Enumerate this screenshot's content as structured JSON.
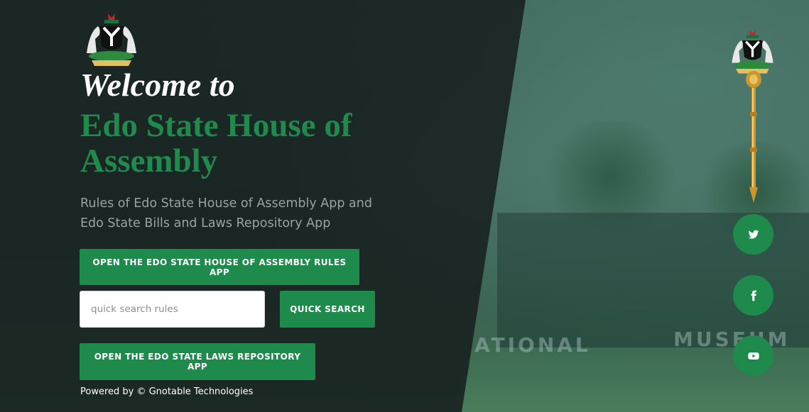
{
  "hero": {
    "welcome": "Welcome to",
    "title": "Edo State House of Assembly",
    "subtitle": "Rules of Edo State House of Assembly App and Edo State Bills and Laws Repository App"
  },
  "actions": {
    "rules_button": "OPEN THE EDO STATE HOUSE OF ASSEMBLY RULES APP",
    "search_placeholder": "quick search rules",
    "search_value": "",
    "search_button": "QUICK SEARCH",
    "laws_button": "OPEN THE EDO STATE LAWS REPOSITORY APP"
  },
  "footer": {
    "powered_by": "Powered by © Gnotable Technologies"
  },
  "background": {
    "sign_text_left": "ATIONAL",
    "sign_text_right": "MUSEUM"
  },
  "social": [
    {
      "icon": "twitter-icon"
    },
    {
      "icon": "facebook-icon"
    },
    {
      "icon": "youtube-icon"
    }
  ],
  "colors": {
    "accent": "#1e8a4b",
    "title_green": "#1f8a4c",
    "panel": "#161e1d"
  }
}
